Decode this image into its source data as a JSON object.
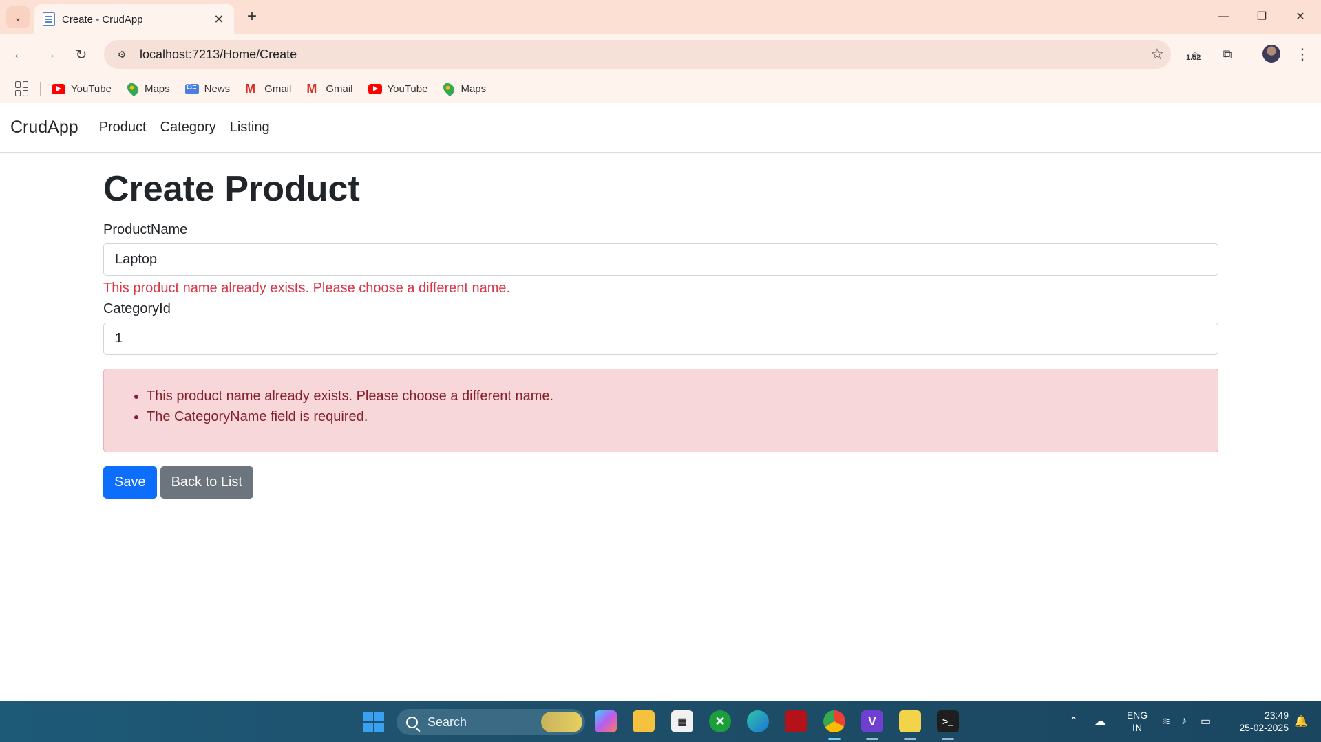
{
  "browser": {
    "tab_title": "Create - CrudApp",
    "url": "localhost:7213/Home/Create",
    "zoom_badge": "1.52",
    "bookmarks": [
      {
        "label": "YouTube",
        "icon": "youtube-icon"
      },
      {
        "label": "Maps",
        "icon": "maps-icon"
      },
      {
        "label": "News",
        "icon": "news-icon"
      },
      {
        "label": "Gmail",
        "icon": "gmail-icon"
      },
      {
        "label": "Gmail",
        "icon": "gmail-icon"
      },
      {
        "label": "YouTube",
        "icon": "youtube-icon"
      },
      {
        "label": "Maps",
        "icon": "maps-icon"
      }
    ]
  },
  "app": {
    "brand": "CrudApp",
    "nav": [
      "Product",
      "Category",
      "Listing"
    ]
  },
  "form": {
    "title": "Create Product",
    "product_name_label": "ProductName",
    "product_name_value": "Laptop",
    "product_name_error": "This product name already exists. Please choose a different name.",
    "category_id_label": "CategoryId",
    "category_id_value": "1",
    "summary_errors": [
      "This product name already exists. Please choose a different name.",
      "The CategoryName field is required."
    ],
    "save_label": "Save",
    "back_label": "Back to List"
  },
  "taskbar": {
    "search_label": "Search",
    "lang_line1": "ENG",
    "lang_line2": "IN",
    "time": "23:49",
    "date": "25-02-2025"
  },
  "colors": {
    "primary": "#0d6efd",
    "secondary": "#6c757d",
    "danger": "#dc3545",
    "alert_bg": "#f8d7da"
  }
}
